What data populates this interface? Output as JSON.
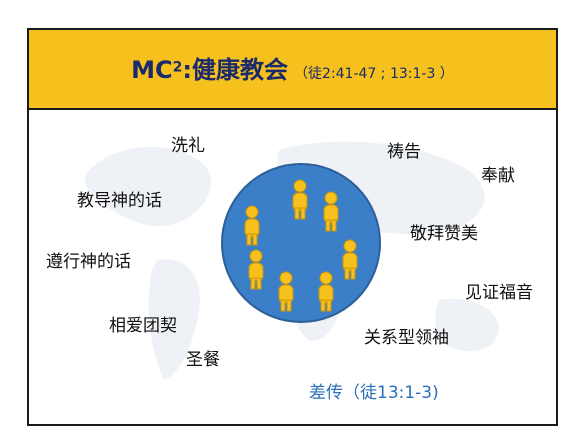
{
  "header": {
    "title_main": "MC",
    "title_sup": "2",
    "title_colon": ":健康教会",
    "title_ref": "（徒2:41-47 ; 13:1-3 ）"
  },
  "labels": {
    "baptism": "洗礼",
    "teach_word": "教导神的话",
    "obey_word": "遵行神的话",
    "love_unity": "相爱团契",
    "communion": "圣餐",
    "prayer": "祷告",
    "offering": "奉献",
    "worship": "敬拜赞美",
    "testimony": "见证福音",
    "relational_leadership": "关系型领袖",
    "sending": "差传（徒13:1-3)"
  },
  "colors": {
    "header_bg": "#F6C11C",
    "circle_fill": "#3A7FC8",
    "people_fill": "#F6C11C",
    "sending_text": "#2b6fb8"
  }
}
